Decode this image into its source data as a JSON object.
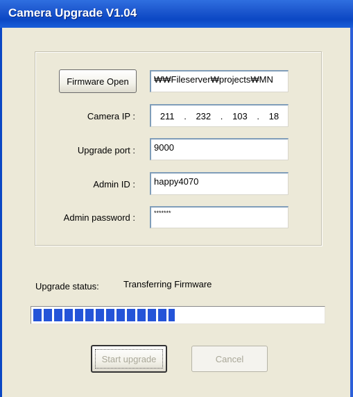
{
  "window": {
    "title": "Camera Upgrade V1.04",
    "title_bar_color": "#0b47c4",
    "face_color": "#ece9d8"
  },
  "firmware": {
    "open_button_label": "Firmware Open",
    "path_value": "₩₩Fileserver₩projects₩MN"
  },
  "camera_ip": {
    "label": "Camera IP :",
    "octets": [
      "211",
      "232",
      "103",
      "18"
    ]
  },
  "upgrade_port": {
    "label": "Upgrade port :",
    "value": "9000"
  },
  "admin_id": {
    "label": "Admin ID :",
    "value": "happy4070"
  },
  "admin_password": {
    "label": "Admin password :",
    "value": "*******"
  },
  "status": {
    "label": "Upgrade status:",
    "value": "Transferring Firmware",
    "progress_fraction": 0.49,
    "progress_color": "#2454d8"
  },
  "buttons": {
    "start_label": "Start upgrade",
    "cancel_label": "Cancel"
  }
}
